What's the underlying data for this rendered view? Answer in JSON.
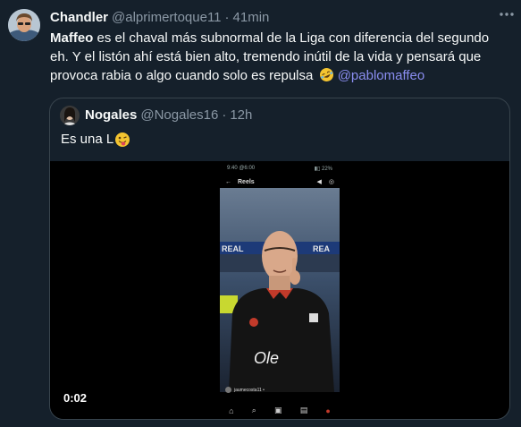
{
  "tweet": {
    "author_name": "Chandler",
    "handle": "@alprimertoque11",
    "separator": "·",
    "time": "41min",
    "text_bold": "Maffeo",
    "text_main": " es el chaval más subnormal de la Liga con diferencia del segundo eh. Y el listón ahí está bien alto, tremendo inútil de la vida y pensará que provoca rabia o algo cuando solo es repulsa ",
    "mention": "@pablomaffeo",
    "emoji": "rolling-on-floor-laughing-emoji"
  },
  "quote": {
    "author_name": "Nogales",
    "handle": "@Nogales16",
    "separator": "·",
    "time": "12h",
    "text": "Es una L",
    "emoji": "winking-tongue-emoji",
    "video": {
      "elapsed": "0:02",
      "screen_title": "Reels",
      "status_time": "9:40 @6:00",
      "status_icons": "▮▯ 22%",
      "reel_user": "jaumecosta11 •"
    }
  },
  "colors": {
    "background": "#15202b",
    "secondary_text": "#8b98a5",
    "mention": "#8a8df0",
    "border": "#38444d"
  }
}
